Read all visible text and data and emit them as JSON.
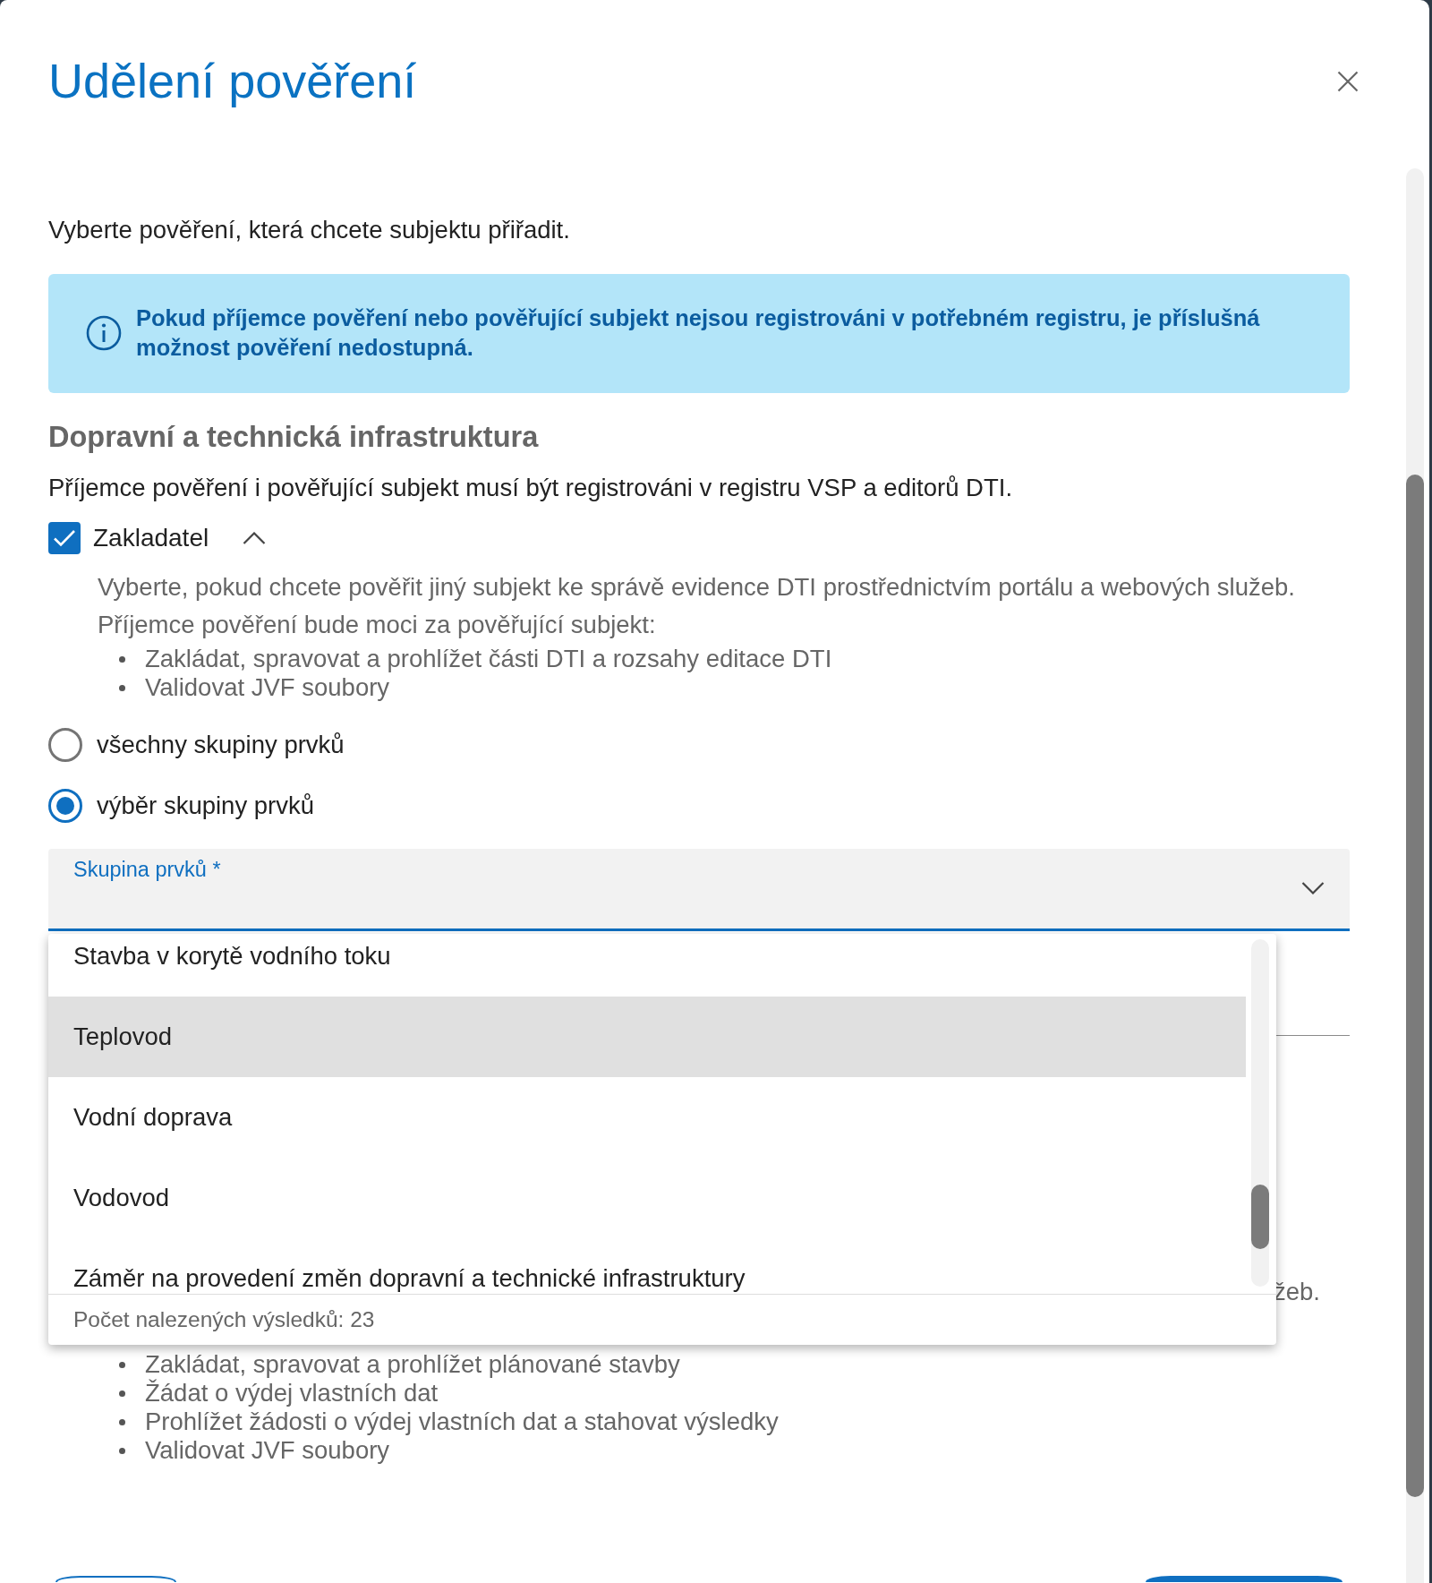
{
  "dialog": {
    "title": "Udělení pověření"
  },
  "section": {
    "intro": "Vyberte pověření, která chcete subjektu přiřadit."
  },
  "info_box": {
    "text": "Pokud příjemce pověření nebo pověřující subjekt nejsou registrováni v potřebném registru, je příslušná možnost pověření nedostupná."
  },
  "group": {
    "heading": "Dopravní a technická infrastruktura",
    "requirement": "Příjemce pověření i pověřující subjekt musí být registrováni v registru VSP a editorů DTI."
  },
  "permission": {
    "label": "Zakladatel",
    "checked": true,
    "expanded": true,
    "description": "Vyberte, pokud chcete pověřit jiný subjekt ke správě evidence DTI prostřednictvím portálu a webových služeb.",
    "rights_intro": "Příjemce pověření bude moci za pověřující subjekt:",
    "rights": [
      "Zakládat, spravovat a prohlížet části DTI a rozsahy editace DTI",
      "Validovat JVF soubory"
    ]
  },
  "scope_options": [
    {
      "label": "všechny skupiny prvků",
      "selected": false
    },
    {
      "label": "výběr skupiny prvků",
      "selected": true
    }
  ],
  "group_select": {
    "label": "Skupina prvků *",
    "open": true,
    "options": [
      {
        "label": "Stavba v korytě vodního toku",
        "highlighted": false
      },
      {
        "label": "Teplovod",
        "highlighted": true
      },
      {
        "label": "Vodní doprava",
        "highlighted": false
      },
      {
        "label": "Vodovod",
        "highlighted": false
      },
      {
        "label": "Záměr na provedení změn dopravní a technické infrastruktury",
        "highlighted": false
      }
    ],
    "result_count": "Počet nalezených výsledků: 23"
  },
  "next_permission": {
    "description_end": "žeb.",
    "rights": [
      "Zakládat, spravovat a prohlížet plánované stavby",
      "Žádat o výdej vlastních dat",
      "Prohlížet žádosti o výdej vlastních dat a stahovat výsledky",
      "Validovat JVF soubory"
    ]
  },
  "footer_buttons": [
    {
      "kind": "secondary"
    },
    {
      "kind": "primary"
    }
  ]
}
